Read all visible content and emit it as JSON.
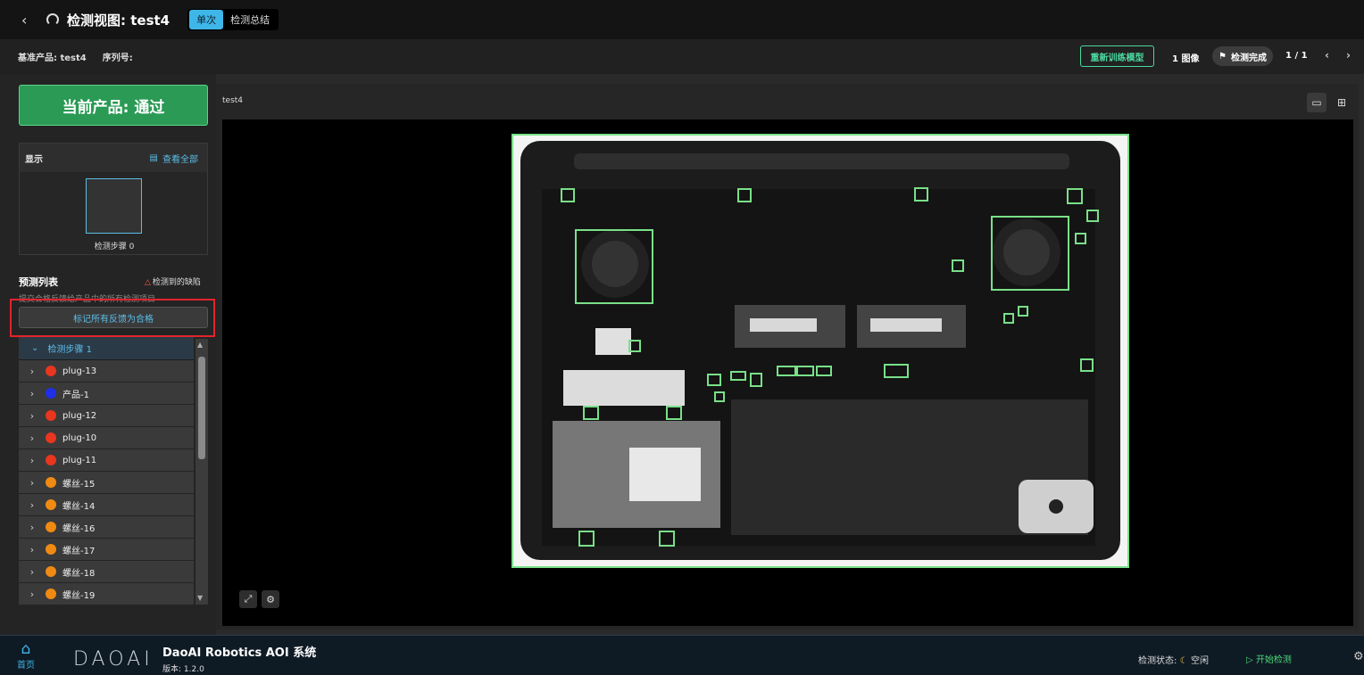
{
  "header": {
    "title": "检测视图: test4",
    "seg_single": "单次",
    "seg_summary": "检测总结"
  },
  "info": {
    "base_label": "基准产品: test4",
    "serial_label": "序列号:",
    "retrain": "重新训练模型",
    "image_count": "1 图像",
    "status_badge": "检测完成",
    "pager": "1 / 1"
  },
  "left": {
    "result": "当前产品: 通过",
    "display_title": "显示",
    "view_all": "查看全部",
    "thumb_label": "检测步骤 0",
    "pred_title": "预测列表",
    "defect_label": "检测到的缺陷",
    "hint": "提交合格反馈给产品中的所有检测项目",
    "mark_all": "标记所有反馈为合格",
    "group": "检测步骤 1",
    "items": [
      {
        "label": "plug-13",
        "color": "#e8361f"
      },
      {
        "label": "产品-1",
        "color": "#1f2fe8"
      },
      {
        "label": "plug-12",
        "color": "#e8361f"
      },
      {
        "label": "plug-10",
        "color": "#e8361f"
      },
      {
        "label": "plug-11",
        "color": "#e8361f"
      },
      {
        "label": "螺丝-15",
        "color": "#f08a12"
      },
      {
        "label": "螺丝-14",
        "color": "#f08a12"
      },
      {
        "label": "螺丝-16",
        "color": "#f08a12"
      },
      {
        "label": "螺丝-17",
        "color": "#f08a12"
      },
      {
        "label": "螺丝-18",
        "color": "#f08a12"
      },
      {
        "label": "螺丝-19",
        "color": "#f08a12"
      }
    ]
  },
  "viewer": {
    "image_name": "test4"
  },
  "footer": {
    "home": "首页",
    "logo": "DAOAI",
    "system": "DaoAI Robotics AOI 系统",
    "version": "版本: 1.2.0",
    "status_label": "检测状态:",
    "status_value": "空闲",
    "start": "开始检测"
  }
}
